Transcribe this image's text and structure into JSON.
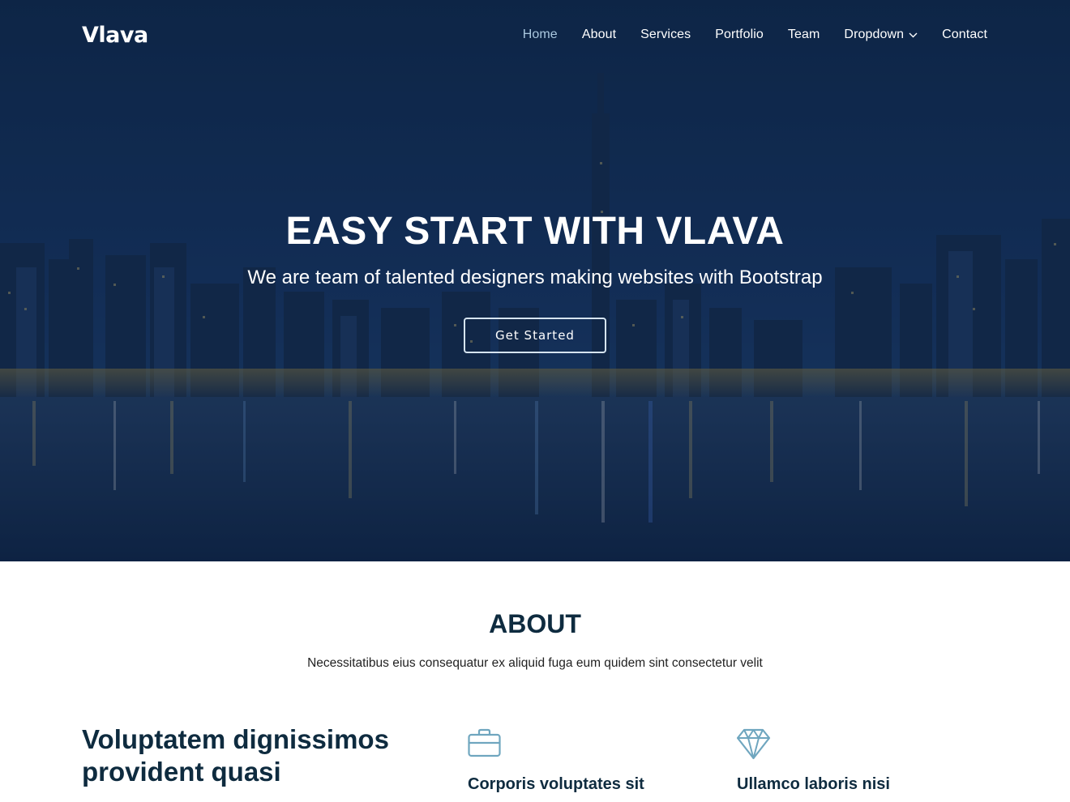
{
  "brand": {
    "logo": "Vlava"
  },
  "nav": {
    "items": [
      {
        "label": "Home",
        "active": true
      },
      {
        "label": "About"
      },
      {
        "label": "Services"
      },
      {
        "label": "Portfolio"
      },
      {
        "label": "Team"
      },
      {
        "label": "Dropdown",
        "has_dropdown": true
      },
      {
        "label": "Contact"
      }
    ]
  },
  "hero": {
    "title": "EASY START WITH VLAVA",
    "subtitle": "We are team of talented designers making websites with Bootstrap",
    "cta_label": "Get Started"
  },
  "about": {
    "title": "ABOUT",
    "subtitle": "Necessitatibus eius consequatur ex aliquid fuga eum quidem sint consectetur velit",
    "heading": "Voluptatem dignissimos provident quasi",
    "features": [
      {
        "icon": "briefcase-icon",
        "title": "Corporis voluptates sit"
      },
      {
        "icon": "gem-icon",
        "title": "Ullamco laboris nisi"
      }
    ]
  },
  "colors": {
    "accent_dark": "#0e2b3f",
    "nav_active": "#a9c7df",
    "icon_stroke": "#6fa6bf"
  }
}
